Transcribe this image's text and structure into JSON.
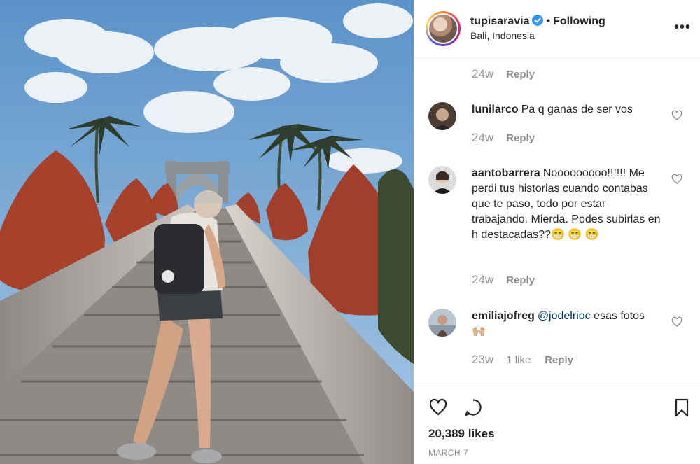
{
  "post": {
    "username": "tupisaravia",
    "separator": "•",
    "follow_status": "Following",
    "location": "Bali, Indonesia",
    "more_label": "•••"
  },
  "top_meta": {
    "time": "24w",
    "reply": "Reply"
  },
  "comments": [
    {
      "user": "lunilarco",
      "text": "Pa q ganas de ser vos",
      "time": "24w",
      "reply": "Reply"
    },
    {
      "user": "aantobarrera",
      "text": "Nooooooooo!!!!!! Me perdi tus historias cuando contabas que te paso, todo por estar trabajando. Mierda. Podes subirlas en h destacadas??😁 😁 😁",
      "time": "24w",
      "reply": "Reply"
    },
    {
      "user": "emiliajofreg",
      "mention": "@jodelrioc",
      "text": " esas fotos 🙌🏼",
      "time": "23w",
      "likes": "1 like",
      "reply": "Reply"
    }
  ],
  "footer": {
    "likes": "20,389 likes",
    "date": "MARCH 7"
  },
  "colors": {
    "verified": "#3897f0",
    "border": "#efefef",
    "muted": "#8e8e8e",
    "text": "#262626"
  },
  "icons": [
    "verified-badge-icon",
    "more-options-icon",
    "heart-icon",
    "comment-icon",
    "bookmark-icon"
  ]
}
